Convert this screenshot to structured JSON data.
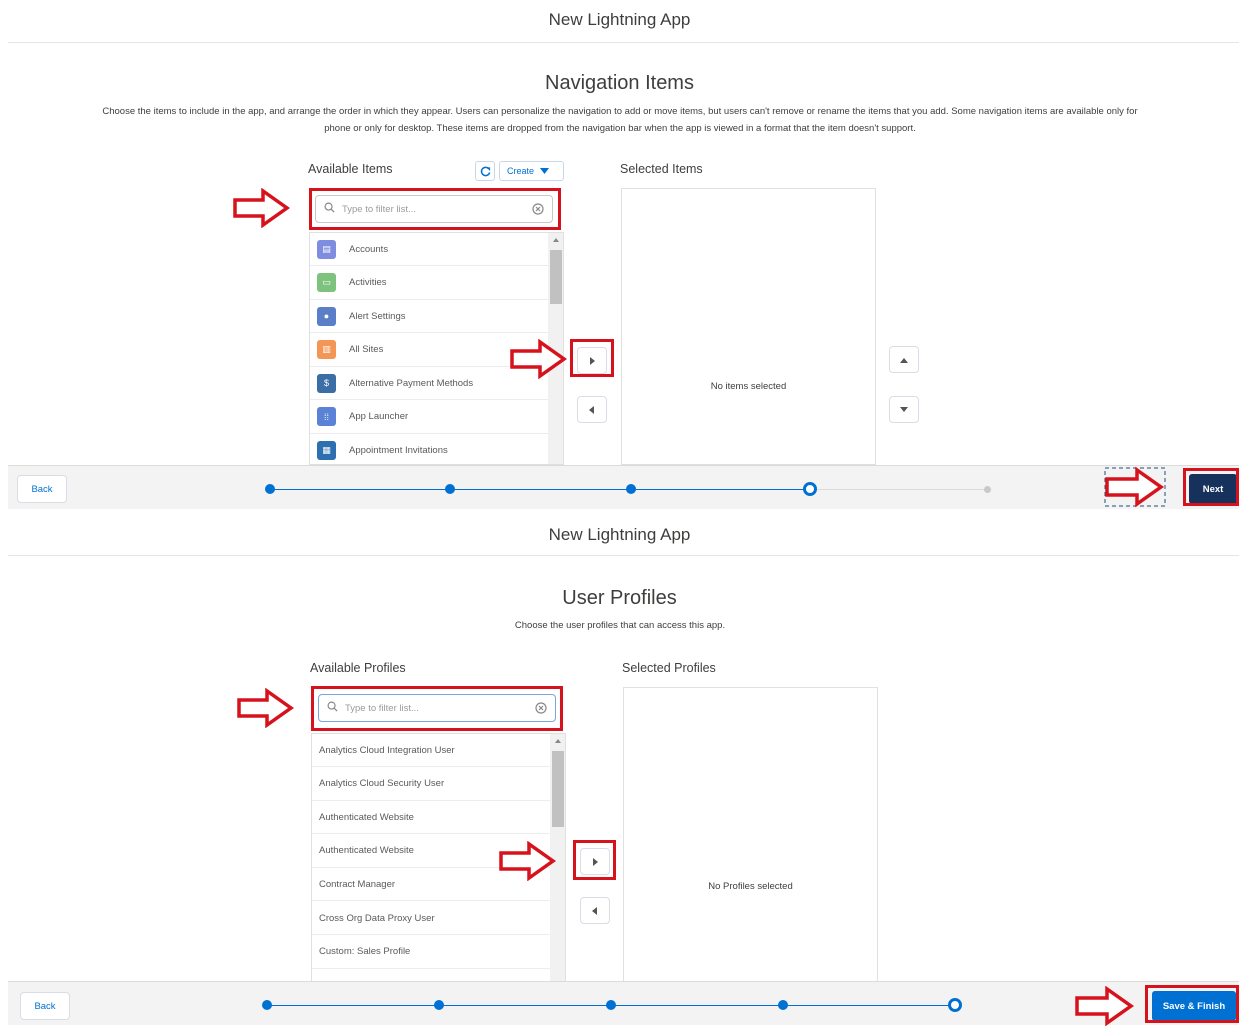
{
  "top": {
    "modal_title": "New Lightning App",
    "step_title": "Navigation Items",
    "description_line1": "Choose the items to include in the app, and arrange the order in which they appear. Users can personalize the navigation to add or move items, but users can't remove or rename the items that you add. Some navigation items are available only for",
    "description_line2": "phone or only for desktop. These items are dropped from the navigation bar when the app is viewed in a format that the item doesn't support.",
    "available_label": "Available Items",
    "create_label": "Create",
    "selected_label": "Selected Items",
    "search_placeholder": "Type to filter list...",
    "items": [
      {
        "label": "Accounts",
        "icon": "account-icon",
        "color": "#7f8de1"
      },
      {
        "label": "Activities",
        "icon": "activity-icon",
        "color": "#7dc37d"
      },
      {
        "label": "Alert Settings",
        "icon": "alert-icon",
        "color": "#5a7ec7"
      },
      {
        "label": "All Sites",
        "icon": "site-icon",
        "color": "#f49756"
      },
      {
        "label": "Alternative Payment Methods",
        "icon": "payment-icon",
        "color": "#3a6ea5"
      },
      {
        "label": "App Launcher",
        "icon": "grid-icon",
        "color": "#5b82d6"
      },
      {
        "label": "Appointment Invitations",
        "icon": "calendar-icon",
        "color": "#2e6fb0"
      }
    ],
    "empty_text": "No items selected",
    "back_label": "Back",
    "next_label": "Next"
  },
  "bottom": {
    "modal_title": "New Lightning App",
    "step_title": "User Profiles",
    "description": "Choose the user profiles that can access this app.",
    "available_label": "Available Profiles",
    "selected_label": "Selected Profiles",
    "search_placeholder": "Type to filter list...",
    "items": [
      "Analytics Cloud Integration User",
      "Analytics Cloud Security User",
      "Authenticated Website",
      "Authenticated Website",
      "Contract Manager",
      "Cross Org Data Proxy User",
      "Custom: Sales Profile"
    ],
    "empty_text": "No Profiles selected",
    "back_label": "Back",
    "finish_label": "Save & Finish"
  },
  "colors": {
    "brand": "#0070d2",
    "highlight": "#d6121c"
  }
}
